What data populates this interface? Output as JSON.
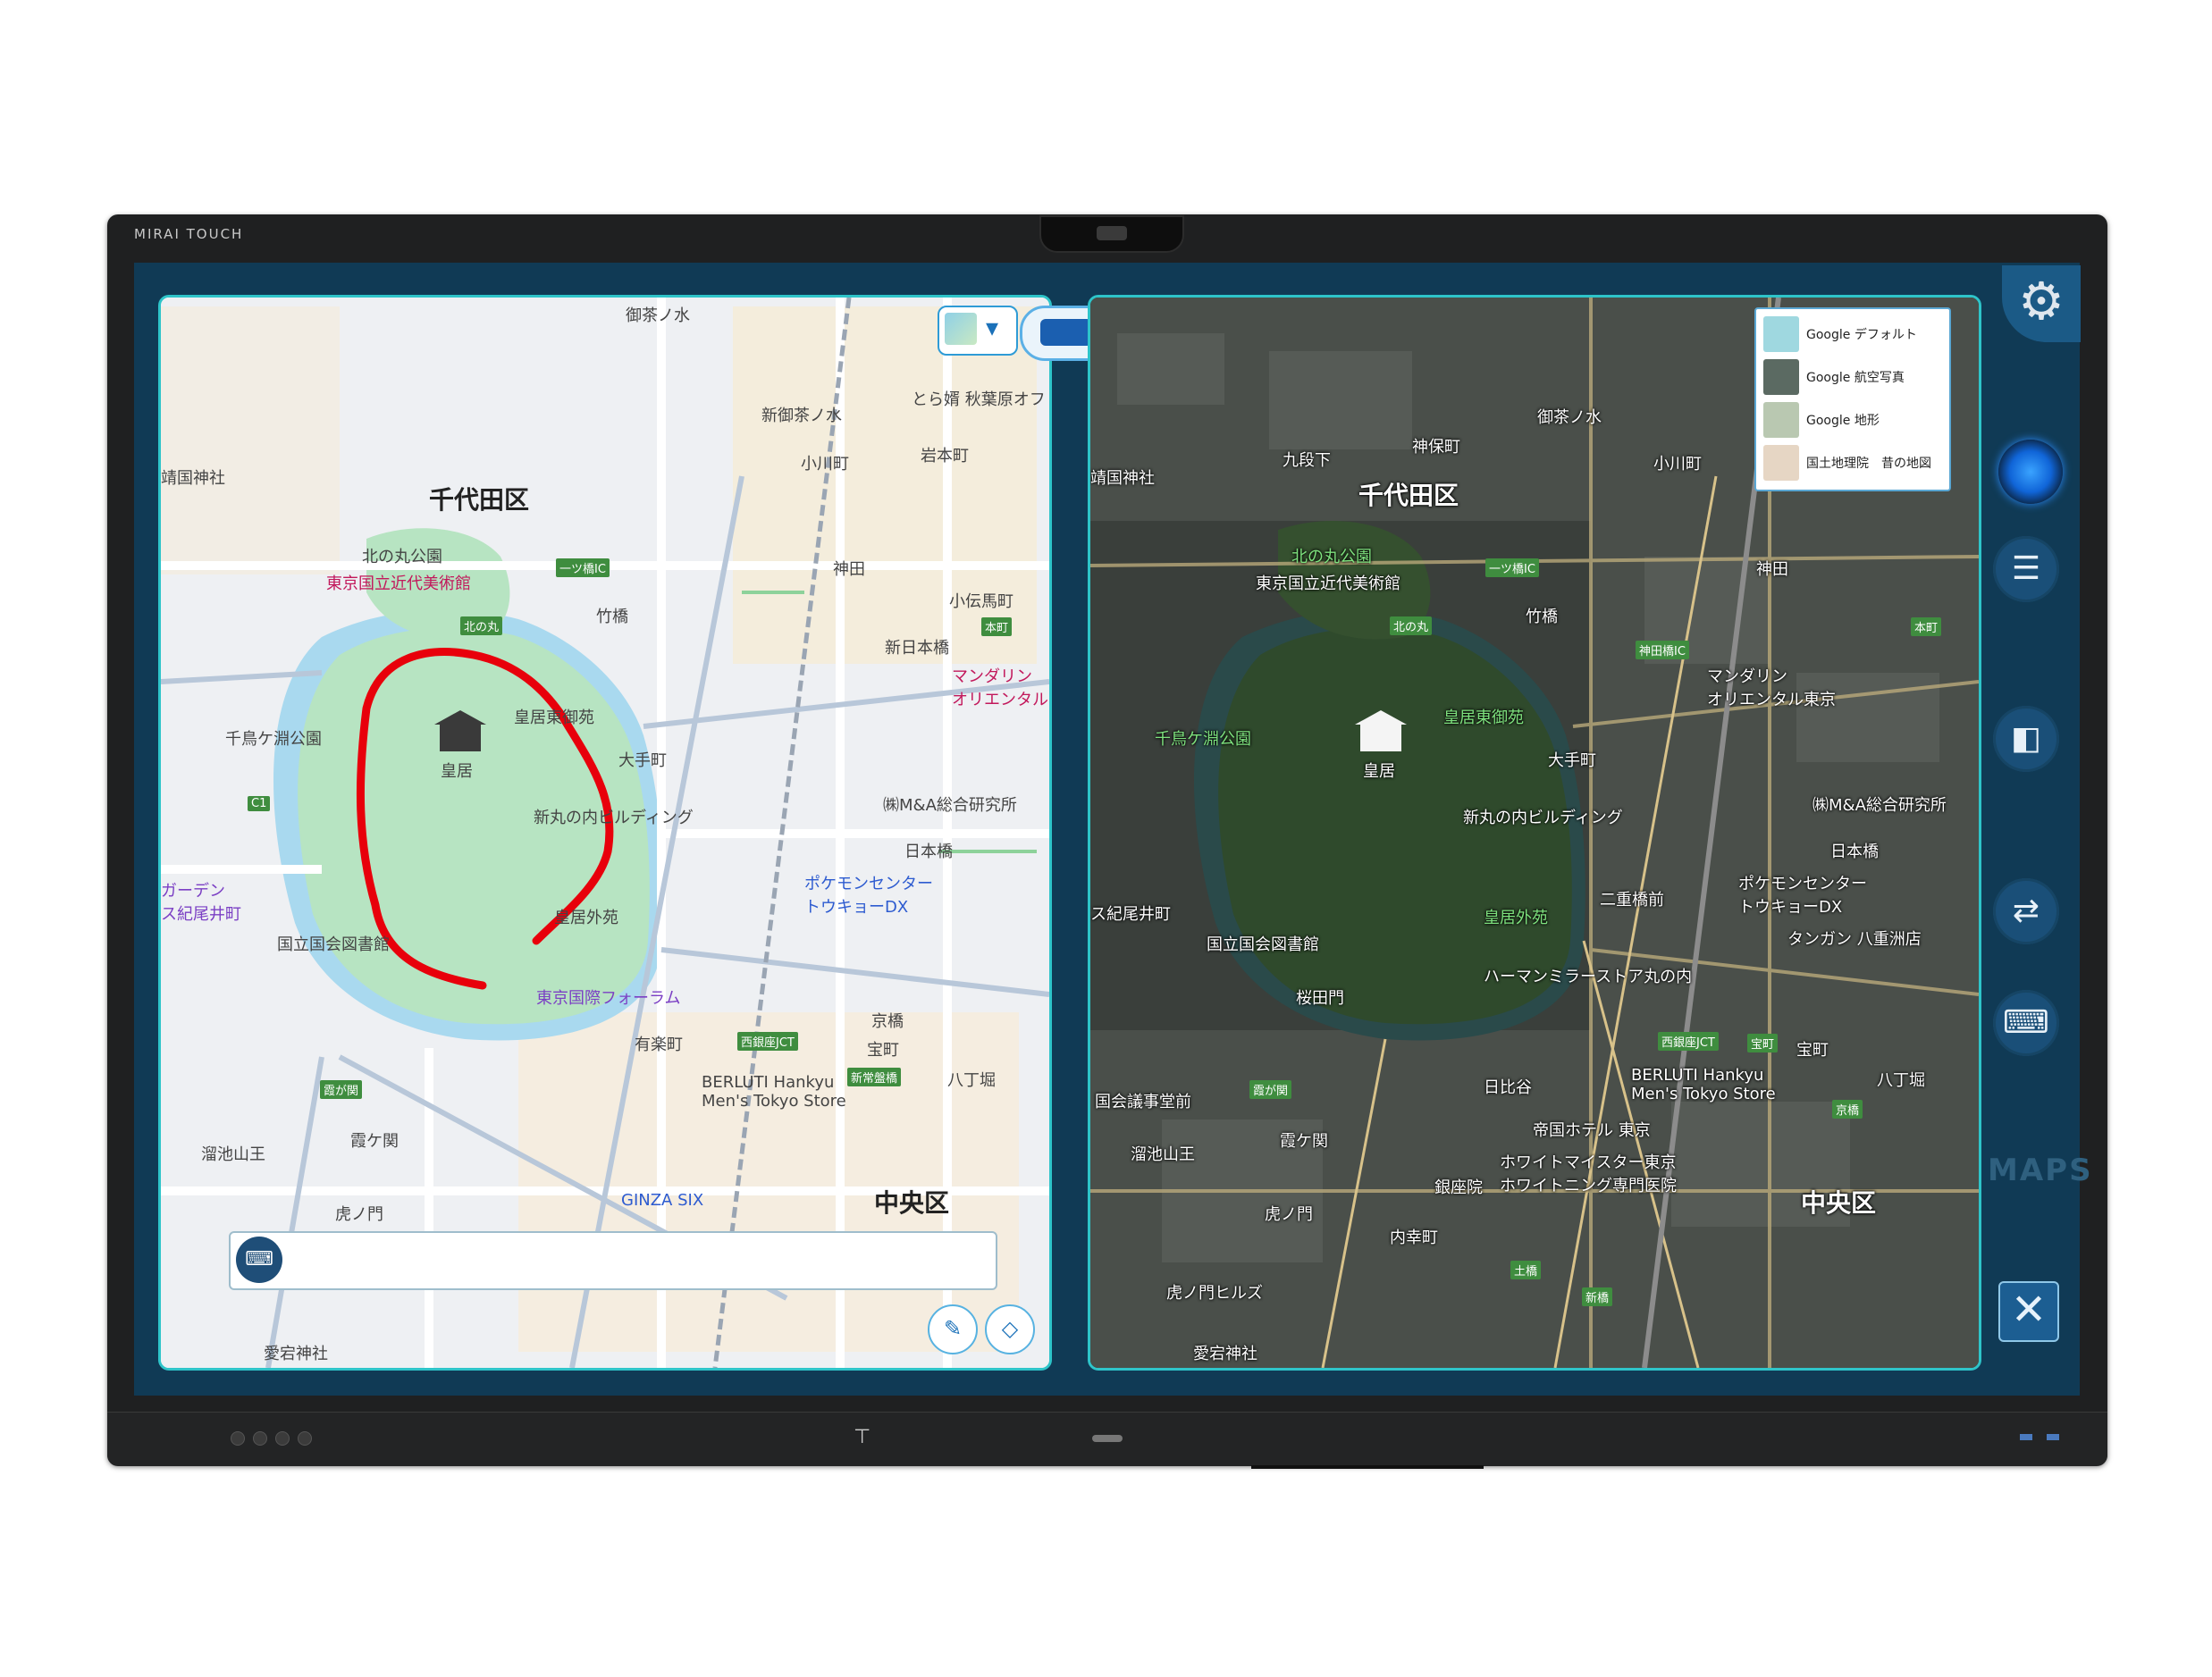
{
  "device": {
    "brand": "MIRAI TOUCH"
  },
  "left_map": {
    "layer_toggle_icon": "map-layer-icon",
    "split_toggle_icon": "split-view-icon",
    "labels": [
      {
        "id": "chiyoda",
        "text": "千代田区",
        "style": "big"
      },
      {
        "id": "kitanomaru",
        "text": "北の丸公園",
        "style": "normal"
      },
      {
        "id": "momat",
        "text": "東京国立近代美術館",
        "style": "pink"
      },
      {
        "id": "kokyo",
        "text": "皇居",
        "style": "normal"
      },
      {
        "id": "higashigyoen",
        "text": "皇居東御苑",
        "style": "normal"
      },
      {
        "id": "chidorigafuchi",
        "text": "千鳥ケ淵公園",
        "style": "normal"
      },
      {
        "id": "shinmarunouchi",
        "text": "新丸の内ビルディング",
        "style": "normal"
      },
      {
        "id": "gaien",
        "text": "皇居外苑",
        "style": "normal"
      },
      {
        "id": "ndl",
        "text": "国立国会図書館",
        "style": "normal"
      },
      {
        "id": "forum",
        "text": "東京国際フォーラム",
        "style": "purple"
      },
      {
        "id": "mandarin",
        "text": "マンダリン\nオリエンタル",
        "style": "pink"
      },
      {
        "id": "mna",
        "text": "㈱M&A総合研究所",
        "style": "normal"
      },
      {
        "id": "nihonbashi",
        "text": "日本橋",
        "style": "normal"
      },
      {
        "id": "pokemon",
        "text": "ポケモンセンター\nトウキョーDX",
        "style": "blue"
      },
      {
        "id": "chuo",
        "text": "中央区",
        "style": "big"
      },
      {
        "id": "ginzasix",
        "text": "GINZA SIX",
        "style": "blue"
      },
      {
        "id": "berluti",
        "text": "BERLUTI Hankyu\nMen's Tokyo Store",
        "style": "normal"
      },
      {
        "id": "kasumigaseki",
        "text": "霞ケ関",
        "style": "normal"
      },
      {
        "id": "toranomon",
        "text": "虎ノ門",
        "style": "normal"
      },
      {
        "id": "tameike",
        "text": "溜池山王",
        "style": "normal"
      },
      {
        "id": "atago",
        "text": "愛宕神社",
        "style": "normal"
      },
      {
        "id": "kanda",
        "text": "神田",
        "style": "normal"
      },
      {
        "id": "ochanomizu",
        "text": "新御茶ノ水",
        "style": "normal"
      },
      {
        "id": "ogawamachi",
        "text": "小川町",
        "style": "normal"
      },
      {
        "id": "iwamotocho",
        "text": "岩本町",
        "style": "normal"
      },
      {
        "id": "shinnihonbashi",
        "text": "新日本橋",
        "style": "normal"
      },
      {
        "id": "kodenmacho",
        "text": "小伝馬町",
        "style": "normal"
      },
      {
        "id": "otemachi",
        "text": "大手町",
        "style": "normal"
      },
      {
        "id": "yurakucho",
        "text": "有楽町",
        "style": "normal"
      },
      {
        "id": "kyobashi",
        "text": "京橋",
        "style": "normal"
      },
      {
        "id": "takaracho",
        "text": "宝町",
        "style": "normal"
      },
      {
        "id": "hatchobori",
        "text": "八丁堀",
        "style": "normal"
      },
      {
        "id": "takebashi",
        "text": "竹橋",
        "style": "normal"
      },
      {
        "id": "yasukuni",
        "text": "靖国神社",
        "style": "normal"
      },
      {
        "id": "toramusu",
        "text": "とら婿 秋葉原オフ",
        "style": "normal"
      },
      {
        "id": "ochanomizu2",
        "text": "御茶ノ水",
        "style": "normal"
      },
      {
        "id": "kioicho",
        "text": "ガーデン\nス紀尾井町",
        "style": "purple"
      }
    ],
    "badges": [
      "北の丸",
      "一ツ橋IC",
      "C1",
      "西銀座JCT",
      "霞が関",
      "本町",
      "新常盤橋"
    ],
    "search": {
      "placeholder": "",
      "value": ""
    },
    "mic_icon": "keyboard-mic-icon",
    "pen_icon": "pen-icon",
    "eraser_icon": "eraser-icon"
  },
  "right_map": {
    "labels": [
      {
        "id": "chiyoda",
        "text": "千代田区",
        "style": "big"
      },
      {
        "id": "kitanomaru",
        "text": "北の丸公園",
        "style": "green"
      },
      {
        "id": "momat",
        "text": "東京国立近代美術館",
        "style": "normal"
      },
      {
        "id": "kokyo",
        "text": "皇居",
        "style": "normal"
      },
      {
        "id": "higashigyoen",
        "text": "皇居東御苑",
        "style": "green"
      },
      {
        "id": "chidorigafuchi",
        "text": "千鳥ケ淵公園",
        "style": "green"
      },
      {
        "id": "shinmarunouchi",
        "text": "新丸の内ビルディング",
        "style": "normal"
      },
      {
        "id": "gaien",
        "text": "皇居外苑",
        "style": "green"
      },
      {
        "id": "ndl",
        "text": "国立国会図書館",
        "style": "normal"
      },
      {
        "id": "mandarin",
        "text": "マンダリン\nオリエンタル東京",
        "style": "normal"
      },
      {
        "id": "mna",
        "text": "㈱M&A総合研究所",
        "style": "normal"
      },
      {
        "id": "nihonbashi",
        "text": "日本橋",
        "style": "normal"
      },
      {
        "id": "pokemon",
        "text": "ポケモンセンター\nトウキョーDX",
        "style": "normal"
      },
      {
        "id": "tangan",
        "text": "タンガン 八重洲店",
        "style": "normal"
      },
      {
        "id": "harmonica",
        "text": "ハーマンミラーストア丸の内",
        "style": "normal"
      },
      {
        "id": "chuo",
        "text": "中央区",
        "style": "big"
      },
      {
        "id": "berluti",
        "text": "BERLUTI Hankyu\nMen's Tokyo Store",
        "style": "normal"
      },
      {
        "id": "imperial",
        "text": "帝国ホテル 東京",
        "style": "normal"
      },
      {
        "id": "whitening",
        "text": "ホワイトマイスター東京\nホワイトニング専門医院",
        "style": "normal"
      },
      {
        "id": "ginzain",
        "text": "銀座院",
        "style": "normal"
      },
      {
        "id": "hibiya",
        "text": "日比谷",
        "style": "normal"
      },
      {
        "id": "kasumigaseki",
        "text": "霞ケ関",
        "style": "normal"
      },
      {
        "id": "tameike",
        "text": "溜池山王",
        "style": "normal"
      },
      {
        "id": "toranomon",
        "text": "虎ノ門",
        "style": "normal"
      },
      {
        "id": "toranomonhills",
        "text": "虎ノ門ヒルズ",
        "style": "normal"
      },
      {
        "id": "atago",
        "text": "愛宕神社",
        "style": "normal"
      },
      {
        "id": "uchisaiwai",
        "text": "内幸町",
        "style": "normal"
      },
      {
        "id": "sakuradamon",
        "text": "桜田門",
        "style": "normal"
      },
      {
        "id": "kokkai",
        "text": "国会議事堂前",
        "style": "normal"
      },
      {
        "id": "kioicho",
        "text": "ス紀尾井町",
        "style": "normal"
      },
      {
        "id": "kanda",
        "text": "神田",
        "style": "normal"
      },
      {
        "id": "kudanshita",
        "text": "九段下",
        "style": "normal"
      },
      {
        "id": "jinbocho",
        "text": "神保町",
        "style": "normal"
      },
      {
        "id": "ogawamachi",
        "text": "小川町",
        "style": "normal"
      },
      {
        "id": "ochanomizu",
        "text": "御茶ノ水",
        "style": "normal"
      },
      {
        "id": "otemachi",
        "text": "大手町",
        "style": "normal"
      },
      {
        "id": "takebashi",
        "text": "竹橋",
        "style": "normal"
      },
      {
        "id": "nijubashi",
        "text": "二重橋前",
        "style": "normal"
      },
      {
        "id": "takaracho",
        "text": "宝町",
        "style": "normal"
      },
      {
        "id": "hatchobori",
        "text": "八丁堀",
        "style": "normal"
      },
      {
        "id": "yasukuni",
        "text": "靖国神社",
        "style": "normal"
      }
    ],
    "badges": [
      "北の丸",
      "一ツ橋IC",
      "神田橋IC",
      "西銀座JCT",
      "霞が関",
      "土橋",
      "新橋",
      "本町",
      "宝町",
      "京橋"
    ],
    "layer_menu": [
      {
        "label": "Google デフォルト",
        "thumb_color": "#9fd8e0"
      },
      {
        "label": "Google 航空写真",
        "thumb_color": "#5b6a62"
      },
      {
        "label": "Google 地形",
        "thumb_color": "#b9c8b1"
      },
      {
        "label": "国土地理院　昔の地図",
        "thumb_color": "#e6d6c4"
      }
    ]
  },
  "sidebar": {
    "settings_icon": "gear-icon",
    "record_icon": "record-icon",
    "list_icon": "list-icon",
    "split_icon": "split-view-icon",
    "swap_icon": "swap-screen-icon",
    "keyboard_icon": "keyboard-mic-icon",
    "app_label": "MAPS",
    "close_icon": "close-icon"
  },
  "colors": {
    "panel_border": "#2ec4c9",
    "draw_stroke": "#e8000b",
    "screen_bg": "#103a55"
  }
}
